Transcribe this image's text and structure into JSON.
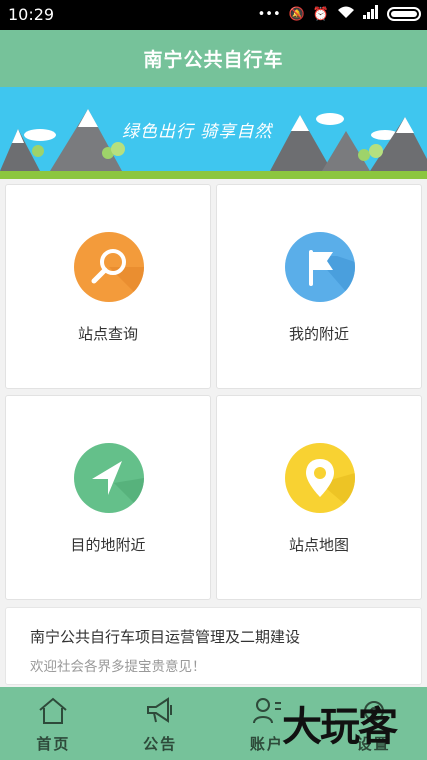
{
  "status_bar": {
    "time": "10:29",
    "icons": [
      "more-dots-icon",
      "mute-icon",
      "alarm-icon",
      "wifi-icon",
      "signal-icon",
      "battery-icon"
    ]
  },
  "header": {
    "title": "南宁公共自行车"
  },
  "banner": {
    "slogan": "绿色出行  骑享自然"
  },
  "menu": {
    "items": [
      {
        "label": "站点查询",
        "icon": "search-icon",
        "color": "#f39b3b"
      },
      {
        "label": "我的附近",
        "icon": "flag-icon",
        "color": "#5aaee9"
      },
      {
        "label": "目的地附近",
        "icon": "navigation-arrow-icon",
        "color": "#64c08a"
      },
      {
        "label": "站点地图",
        "icon": "map-pin-icon",
        "color": "#f8d232"
      }
    ]
  },
  "notice": {
    "title": "南宁公共自行车项目运营管理及二期建设",
    "subtitle": "欢迎社会各界多提宝贵意见！"
  },
  "tabbar": {
    "tabs": [
      {
        "label": "首页",
        "icon": "home-icon"
      },
      {
        "label": "公告",
        "icon": "megaphone-icon"
      },
      {
        "label": "账户",
        "icon": "user-icon"
      },
      {
        "label": "设置",
        "icon": "settings-icon"
      }
    ]
  },
  "watermark": {
    "text": "大玩客"
  },
  "colors": {
    "primary_green": "#76c29a",
    "banner_sky": "#3fc6ef",
    "status_bar": "#000000"
  }
}
